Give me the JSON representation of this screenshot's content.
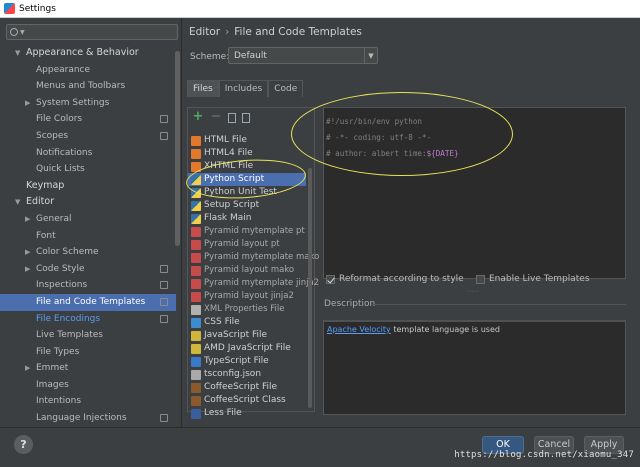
{
  "window": {
    "title": "Settings"
  },
  "left": {
    "search_placeholder": "Q▾",
    "tree": [
      {
        "label": "Appearance & Behavior",
        "expanded": true,
        "bold": true
      },
      {
        "label": "Appearance"
      },
      {
        "label": "Menus and Toolbars"
      },
      {
        "label": "System Settings",
        "expandable": true
      },
      {
        "label": "File Colors",
        "config": true
      },
      {
        "label": "Scopes",
        "config": true
      },
      {
        "label": "Notifications"
      },
      {
        "label": "Quick Lists"
      },
      {
        "label": "Keymap",
        "bold": true
      },
      {
        "label": "Editor",
        "expanded": true,
        "bold": true
      },
      {
        "label": "General",
        "expandable": true
      },
      {
        "label": "Font"
      },
      {
        "label": "Color Scheme",
        "expandable": true
      },
      {
        "label": "Code Style",
        "expandable": true,
        "config": true
      },
      {
        "label": "Inspections",
        "config": true
      },
      {
        "label": "File and Code Templates",
        "config": true,
        "selected": true
      },
      {
        "label": "File Encodings",
        "config": true,
        "link": true
      },
      {
        "label": "Live Templates"
      },
      {
        "label": "File Types"
      },
      {
        "label": "Emmet",
        "expandable": true
      },
      {
        "label": "Images"
      },
      {
        "label": "Intentions"
      },
      {
        "label": "Language Injections",
        "config": true
      }
    ]
  },
  "right": {
    "breadcrumb": [
      "Editor",
      "File and Code Templates"
    ],
    "scheme_label": "Scheme:",
    "scheme_value": "Default",
    "tabs": [
      "Files",
      "Includes",
      "Code"
    ],
    "active_tab": "Files",
    "files": [
      {
        "name": "HTML File",
        "icon": "html"
      },
      {
        "name": "HTML4 File",
        "icon": "html"
      },
      {
        "name": "XHTML File",
        "icon": "html"
      },
      {
        "name": "Python Script",
        "icon": "python",
        "selected": true
      },
      {
        "name": "Python Unit Test",
        "icon": "python"
      },
      {
        "name": "Setup Script",
        "icon": "python"
      },
      {
        "name": "Flask Main",
        "icon": "python"
      },
      {
        "name": "Pyramid mytemplate pt",
        "icon": "pyramid",
        "grey": true
      },
      {
        "name": "Pyramid layout pt",
        "icon": "pyramid",
        "grey": true
      },
      {
        "name": "Pyramid mytemplate mako",
        "icon": "pyramid",
        "grey": true
      },
      {
        "name": "Pyramid layout mako",
        "icon": "pyramid",
        "grey": true
      },
      {
        "name": "Pyramid mytemplate jinja2",
        "icon": "pyramid",
        "grey": true
      },
      {
        "name": "Pyramid layout jinja2",
        "icon": "pyramid",
        "grey": true
      },
      {
        "name": "XML Properties File",
        "icon": "xml",
        "grey": true
      },
      {
        "name": "CSS File",
        "icon": "css"
      },
      {
        "name": "JavaScript File",
        "icon": "js"
      },
      {
        "name": "AMD JavaScript File",
        "icon": "js"
      },
      {
        "name": "TypeScript File",
        "icon": "ts"
      },
      {
        "name": "tsconfig.json",
        "icon": "json"
      },
      {
        "name": "CoffeeScript File",
        "icon": "coffee"
      },
      {
        "name": "CoffeeScript Class",
        "icon": "coffee"
      },
      {
        "name": "Less File",
        "icon": "less"
      }
    ],
    "code": {
      "line1": "#!/usr/bin/env python",
      "line2": "# -*- coding: utf-8 -*-",
      "line3_prefix": "# author: albert time:",
      "line3_var": "${DATE}"
    },
    "reformat_label": "Reformat according to style",
    "reformat_checked": true,
    "live_label": "Enable Live Templates",
    "live_checked": false,
    "description_label": "Description",
    "description_link": "Apache Velocity",
    "description_text": " template language is used"
  },
  "buttons": {
    "help": "?",
    "ok": "OK",
    "cancel": "Cancel",
    "apply": "Apply"
  },
  "watermark": "https://blog.csdn.net/xiaomu_347",
  "colors": {
    "selection": "#4b6eaf",
    "annotation": "#e8e35a",
    "link": "#589df6"
  }
}
